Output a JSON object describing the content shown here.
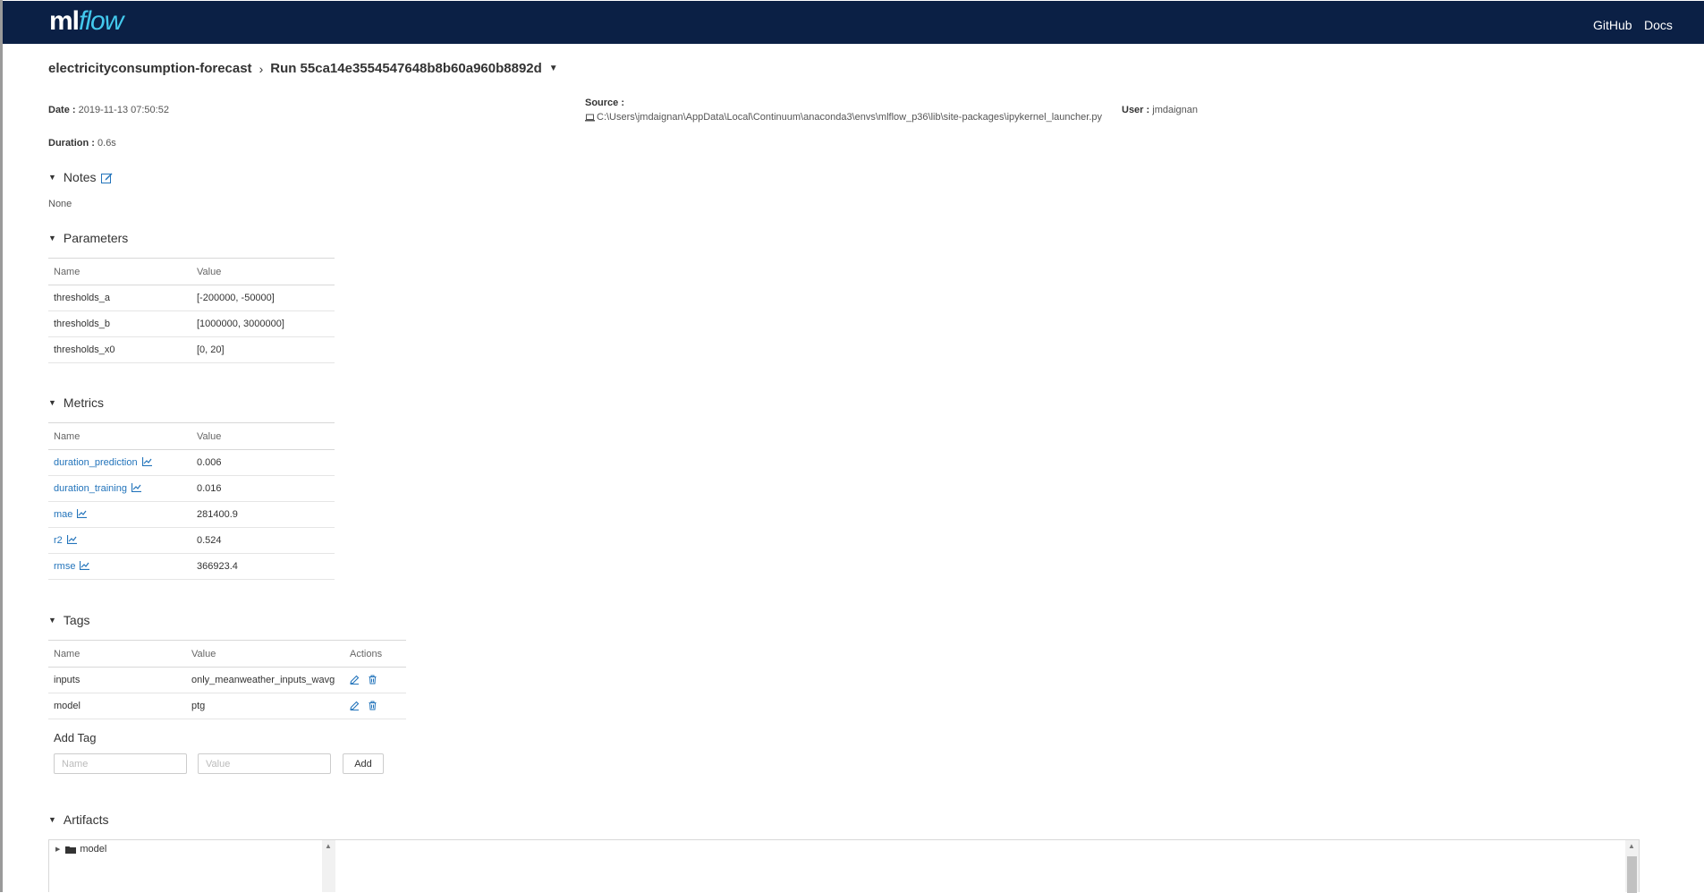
{
  "app": {
    "logo_ml": "ml",
    "logo_flow": "flow",
    "nav": {
      "github": "GitHub",
      "docs": "Docs"
    }
  },
  "breadcrumb": {
    "experiment": "electricityconsumption-forecast",
    "separator": "›",
    "run": "Run 55ca14e3554547648b8b60a960b8892d"
  },
  "meta": {
    "date_label": "Date :",
    "date_value": "2019-11-13 07:50:52",
    "source_label": "Source :",
    "source_value": "C:\\Users\\jmdaignan\\AppData\\Local\\Continuum\\anaconda3\\envs\\mlflow_p36\\lib\\site-packages\\ipykernel_launcher.py",
    "user_label": "User :",
    "user_value": "jmdaignan",
    "duration_label": "Duration :",
    "duration_value": "0.6s"
  },
  "notes": {
    "title": "Notes",
    "value": "None"
  },
  "parameters": {
    "title": "Parameters",
    "columns": [
      "Name",
      "Value"
    ],
    "rows": [
      {
        "name": "thresholds_a",
        "value": "[-200000, -50000]"
      },
      {
        "name": "thresholds_b",
        "value": "[1000000, 3000000]"
      },
      {
        "name": "thresholds_x0",
        "value": "[0, 20]"
      }
    ]
  },
  "metrics": {
    "title": "Metrics",
    "columns": [
      "Name",
      "Value"
    ],
    "rows": [
      {
        "name": "duration_prediction",
        "value": "0.006"
      },
      {
        "name": "duration_training",
        "value": "0.016"
      },
      {
        "name": "mae",
        "value": "281400.9"
      },
      {
        "name": "r2",
        "value": "0.524"
      },
      {
        "name": "rmse",
        "value": "366923.4"
      }
    ]
  },
  "tags": {
    "title": "Tags",
    "columns": [
      "Name",
      "Value",
      "Actions"
    ],
    "rows": [
      {
        "name": "inputs",
        "value": "only_meanweather_inputs_wavg"
      },
      {
        "name": "model",
        "value": "ptg"
      }
    ],
    "add_title": "Add Tag",
    "name_placeholder": "Name",
    "value_placeholder": "Value",
    "add_button": "Add"
  },
  "artifacts": {
    "title": "Artifacts",
    "items": [
      {
        "name": "model"
      }
    ]
  },
  "icons": {
    "edit": "edit-icon",
    "chart": "line-chart-icon",
    "pencil": "pencil-icon",
    "trash": "trash-icon",
    "folder": "folder-icon",
    "caret": "caret-down-icon"
  },
  "colors": {
    "topbar": "#0b2045",
    "link": "#2374bb",
    "logo_flow": "#43c9ed"
  }
}
